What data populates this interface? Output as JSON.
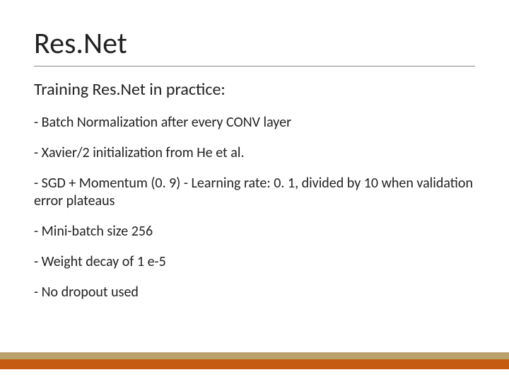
{
  "title": "Res.Net",
  "subtitle": "Training Res.Net in practice:",
  "bullets": [
    "- Batch Normalization after every CONV layer",
    "- Xavier/2 initialization from He et al.",
    "- SGD + Momentum (0. 9) - Learning rate: 0. 1, divided by 10 when validation error plateaus",
    "- Mini-batch size 256",
    "- Weight decay of 1 e-5",
    "- No dropout used"
  ],
  "colors": {
    "band_top": "#b9a16b",
    "band_bottom": "#c55a11"
  }
}
